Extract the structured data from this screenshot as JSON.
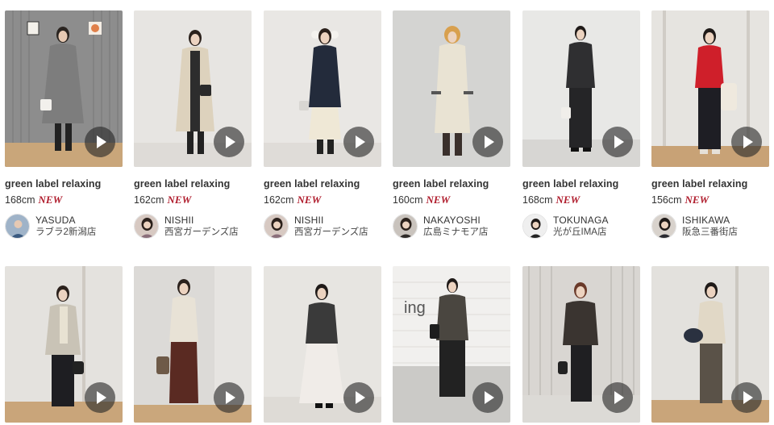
{
  "cards": [
    {
      "brand": "green label relaxing",
      "height": "168cm",
      "badge": "NEW",
      "staff_name": "YASUDA",
      "shop": "ラブラ2新潟店",
      "bg": "#8d8d8d",
      "floor": "#c9a67a",
      "coat": "#7d7d7d",
      "hair": "#2a2420",
      "avatar_bg": "#9fb3c8"
    },
    {
      "brand": "green label relaxing",
      "height": "162cm",
      "badge": "NEW",
      "staff_name": "NISHII",
      "shop": "西宮ガーデンズ店",
      "bg": "#e7e5e2",
      "floor": "#dedbd7",
      "coat": "#ddd2bd",
      "hair": "#2b211c",
      "avatar_bg": "#d7c9c2"
    },
    {
      "brand": "green label relaxing",
      "height": "162cm",
      "badge": "NEW",
      "staff_name": "NISHII",
      "shop": "西宮ガーデンズ店",
      "bg": "#e9e7e4",
      "floor": "#dfdcd8",
      "coat": "#232b3b",
      "hair": "#2b211c",
      "avatar_bg": "#d7c9c2"
    },
    {
      "brand": "green label relaxing",
      "height": "160cm",
      "badge": "NEW",
      "staff_name": "NAKAYOSHI",
      "shop": "広島ミナモア店",
      "bg": "#d4d4d2",
      "floor": "#cfcfcd",
      "coat": "#e9e3d3",
      "hair": "#d8a04e",
      "avatar_bg": "#c9c3bd"
    },
    {
      "brand": "green label relaxing",
      "height": "168cm",
      "badge": "NEW",
      "staff_name": "TOKUNAGA",
      "shop": "光が丘IMA店",
      "bg": "#e8e8e6",
      "floor": "#d7d6d3",
      "coat": "#2f2f31",
      "hair": "#1f1a18",
      "avatar_bg": "#efefef"
    },
    {
      "brand": "green label relaxing",
      "height": "156cm",
      "badge": "NEW",
      "staff_name": "ISHIKAWA",
      "shop": "阪急三番街店",
      "bg": "#e6e4e0",
      "floor": "#c8a276",
      "coat": "#cf1f2a",
      "hair": "#1f1a18",
      "avatar_bg": "#d8d2cc"
    },
    {
      "bg": "#e4e2de",
      "floor": "#c9a57a",
      "coat": "#c9c3b6",
      "hair": "#2b211c"
    },
    {
      "bg": "#dcdad7",
      "floor": "#caa77c",
      "coat": "#e8e2d6",
      "hair": "#2b211c"
    },
    {
      "bg": "#e7e5e1",
      "floor": "#dedbd6",
      "coat": "#3a3a3a",
      "hair": "#1f1a18"
    },
    {
      "bg": "#f1f0ee",
      "floor": "#cbcac7",
      "coat": "#4a4640",
      "hair": "#1f1a18"
    },
    {
      "bg": "#d9d6d2",
      "floor": "#dcdad6",
      "coat": "#3a3430",
      "hair": "#6a3a2a"
    },
    {
      "bg": "#e3e1dd",
      "floor": "#c9a57a",
      "coat": "#e1d8c6",
      "hair": "#1f1a18"
    }
  ]
}
